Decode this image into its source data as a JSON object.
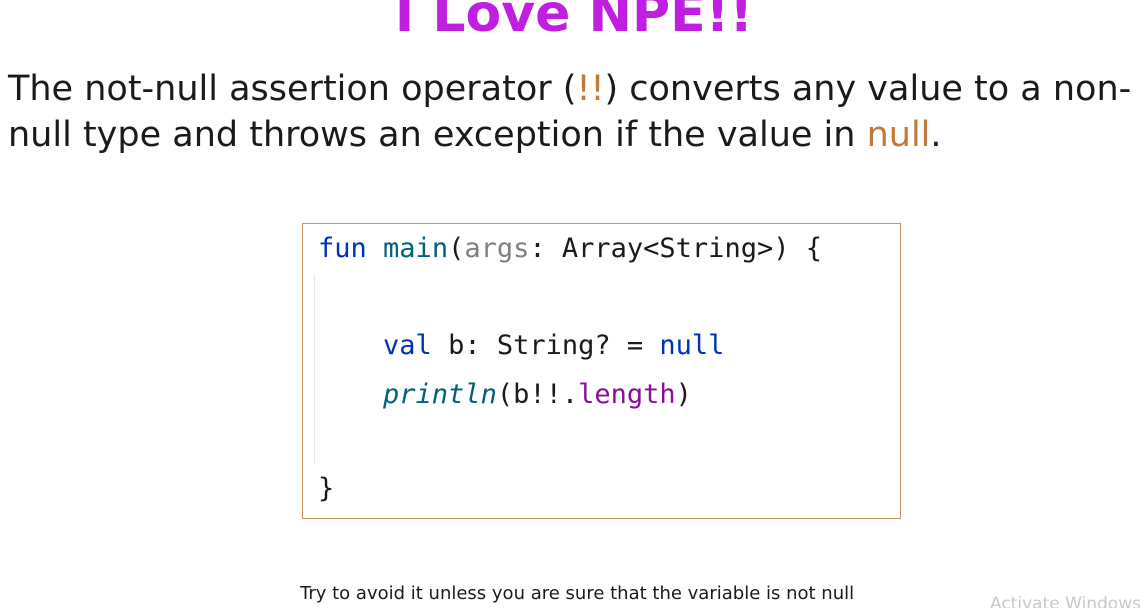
{
  "slide": {
    "title": "I Love NPE!!",
    "paragraph": {
      "line1_part1": "The not-null assertion operator (",
      "line1_operator": "!!",
      "line1_part2": ") converts any value to a non-",
      "line2_part1": "null type and throws an exception if the value in ",
      "line2_null": "null",
      "line2_end": "."
    },
    "code": {
      "line1": {
        "kw_fun": "fun",
        "fn_name": "main",
        "open_paren": "(",
        "param": "args",
        "type_sig": ": Array<String>) {"
      },
      "line2": {
        "kw_val": "val",
        "decl": " b: String? = ",
        "kw_null": "null"
      },
      "line3": {
        "call": "println",
        "args_start": "(b!!.",
        "prop": "length",
        "args_end": ")"
      },
      "line4": {
        "close_brace": "}"
      }
    },
    "footer": "Try to avoid it unless you are sure that the variable is not null",
    "watermark": "Activate Windows",
    "colors": {
      "title": "#c01ee0",
      "accent": "#c07a3c",
      "code_border": "#c59463"
    }
  }
}
